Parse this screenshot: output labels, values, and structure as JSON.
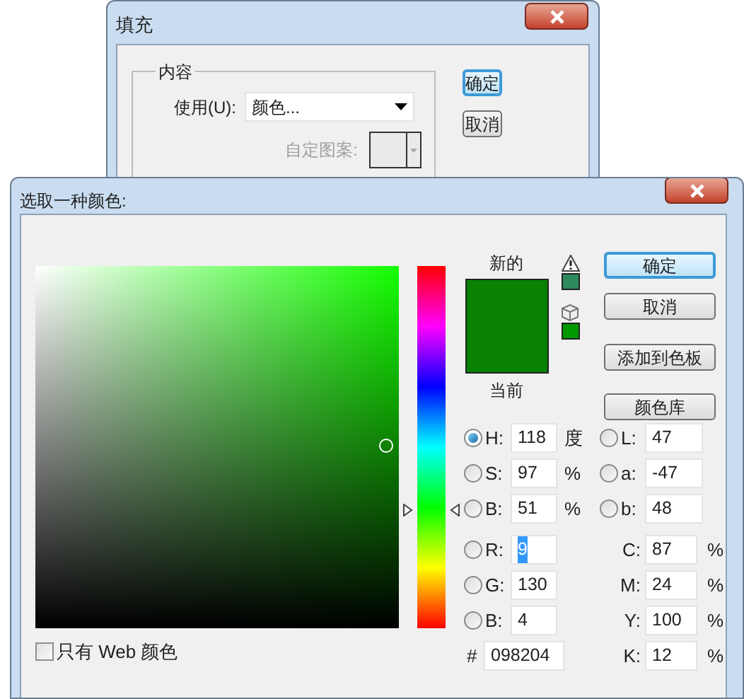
{
  "fill_dialog": {
    "title": "填充",
    "group_title": "内容",
    "use_label": "使用(U):",
    "use_value": "颜色...",
    "pattern_label": "自定图案:",
    "pattern_disabled": true,
    "buttons": [
      {
        "label": "确定",
        "default": true
      },
      {
        "label": "取消",
        "default": false
      }
    ]
  },
  "picker_dialog": {
    "title": "选取一种颜色:",
    "new_label": "新的",
    "current_label": "当前",
    "alerts": [
      {
        "kind": "gamut_warning",
        "color": "#2e8a5e"
      },
      {
        "kind": "web_safe",
        "color": "#009900"
      }
    ],
    "buttons": [
      {
        "label": "确定",
        "default": true
      },
      {
        "label": "取消",
        "default": false
      },
      {
        "label": "添加到色板",
        "default": false
      },
      {
        "label": "颜色库",
        "default": false
      }
    ],
    "left_fields": [
      {
        "kind": "radio",
        "selected": true,
        "label": "H:",
        "value": "118",
        "unit": "度",
        "highlighted": false
      },
      {
        "kind": "radio",
        "selected": false,
        "label": "S:",
        "value": "97",
        "unit": "%",
        "highlighted": false
      },
      {
        "kind": "radio",
        "selected": false,
        "label": "B:",
        "value": "51",
        "unit": "%",
        "highlighted": false
      },
      {
        "kind": "radio",
        "selected": false,
        "label": "R:",
        "value": "9",
        "highlighted": true
      },
      {
        "kind": "radio",
        "selected": false,
        "label": "G:",
        "value": "130",
        "highlighted": false
      },
      {
        "kind": "radio",
        "selected": false,
        "label": "B:",
        "value": "4",
        "highlighted": false
      },
      {
        "kind": "hex",
        "label": "#",
        "value": "098204",
        "highlighted": false
      }
    ],
    "right_fields": [
      {
        "kind": "radio",
        "selected": false,
        "label": "L:",
        "value": "47",
        "highlighted": false
      },
      {
        "kind": "radio",
        "selected": false,
        "label": "a:",
        "value": "-47",
        "highlighted": false
      },
      {
        "kind": "radio",
        "selected": false,
        "label": "b:",
        "value": "48",
        "highlighted": false
      },
      {
        "kind": "plain",
        "label": "C:",
        "value": "87",
        "unit": "%",
        "highlighted": false
      },
      {
        "kind": "plain",
        "label": "M:",
        "value": "24",
        "unit": "%",
        "highlighted": false
      },
      {
        "kind": "plain",
        "label": "Y:",
        "value": "100",
        "unit": "%",
        "highlighted": false
      },
      {
        "kind": "plain",
        "label": "K:",
        "value": "12",
        "unit": "%",
        "highlighted": false
      }
    ],
    "web_only": {
      "label": "只有 Web 颜色",
      "checked": false
    }
  }
}
